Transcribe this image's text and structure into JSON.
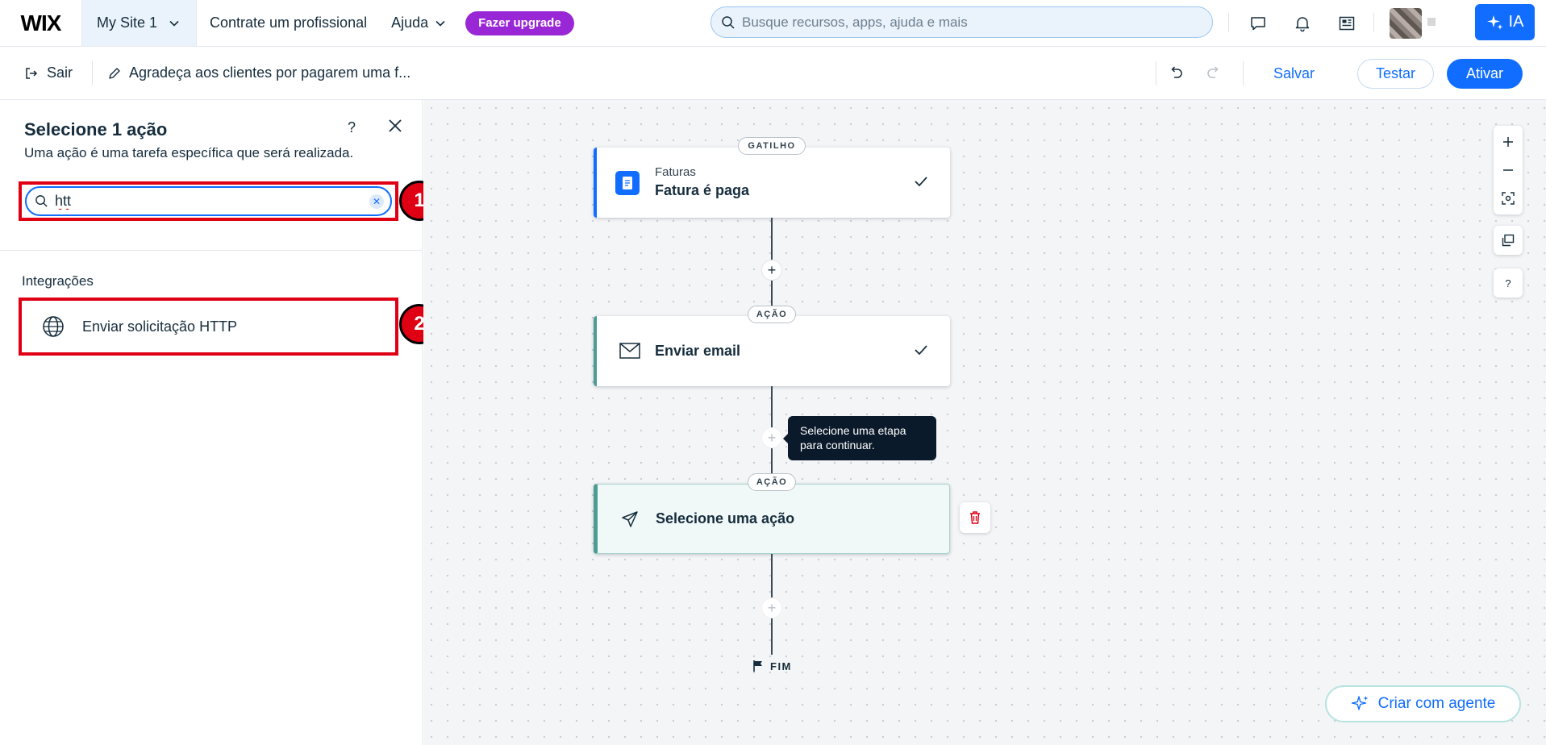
{
  "topbar": {
    "logo": "WIX",
    "site_name": "My Site 1",
    "hire_pro": "Contrate um profissional",
    "help": "Ajuda",
    "upgrade": "Fazer upgrade",
    "search_placeholder": "Busque recursos, apps, ajuda e mais",
    "ai_label": "IA"
  },
  "toolbar": {
    "exit": "Sair",
    "automation_name": "Agradeça aos clientes por pagarem uma f...",
    "save": "Salvar",
    "test": "Testar",
    "activate": "Ativar"
  },
  "panel": {
    "title": "Selecione 1 ação",
    "subtitle": "Uma ação é uma tarefa específica que será realizada.",
    "help": "?",
    "search_value": "htt",
    "section": "Integrações",
    "items": [
      {
        "label": "Enviar solicitação HTTP",
        "icon": "globe-icon"
      }
    ]
  },
  "annotations": [
    "1",
    "2"
  ],
  "flow": {
    "trigger": {
      "tag": "GATILHO",
      "category": "Faturas",
      "title": "Fatura é paga",
      "icon": "invoice-icon"
    },
    "action1": {
      "tag": "AÇÃO",
      "title": "Enviar email",
      "icon": "mail-icon"
    },
    "tooltip": "Selecione uma etapa para continuar.",
    "action2": {
      "tag": "AÇÃO",
      "title": "Selecione uma ação",
      "icon": "send-icon"
    },
    "end": "FIM"
  },
  "canvas_tools": {
    "help": "?"
  },
  "agent_button": "Criar com agente",
  "colors": {
    "accent": "#116dff",
    "upgrade": "#9a27d5",
    "highlight": "#e00014",
    "action": "#4a9c94"
  }
}
